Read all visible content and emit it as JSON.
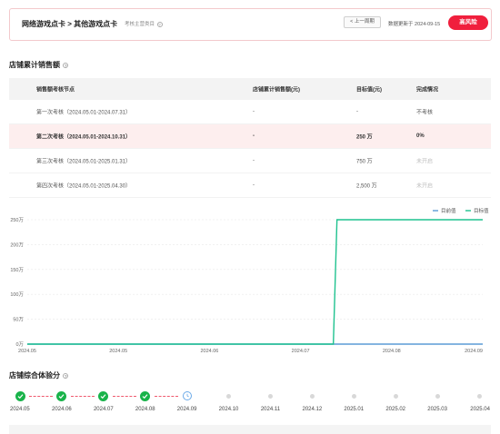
{
  "header": {
    "title": "网络游戏点卡 > 其他游戏点卡",
    "subtitle": "考核主营类目",
    "prev_button": "< 上一周期",
    "update_text": "数据更新于 2024-09-15",
    "risk_button": "高风险"
  },
  "sales_section": {
    "title": "店铺累计销售额",
    "columns": [
      "销售额考核节点",
      "店铺累计销售额(元)",
      "目标值(元)",
      "完成情况"
    ],
    "rows": [
      {
        "node": "第一次考核（2024.05.01-2024.07.31）",
        "sales": "-",
        "target": "-",
        "status": "不考核"
      },
      {
        "node": "第二次考核（2024.05.01-2024.10.31）",
        "sales": "-",
        "target": "250 万",
        "status": "0%"
      },
      {
        "node": "第三次考核（2024.05.01-2025.01.31）",
        "sales": "-",
        "target": "750 万",
        "status": "未开启"
      },
      {
        "node": "第四次考核（2024.05.01-2025.04.30）",
        "sales": "-",
        "target": "2,500 万",
        "status": "未开启"
      }
    ]
  },
  "chart_data": {
    "type": "line",
    "legend": [
      "目前值",
      "目标值"
    ],
    "legend_position": "top-right",
    "x_ticks": [
      "2024.05",
      "2024.05",
      "2024.06",
      "2024.07",
      "2024.08",
      "2024.09"
    ],
    "y_ticks": [
      "0万",
      "50万",
      "100万",
      "150万",
      "200万",
      "250万"
    ],
    "ylim": [
      0,
      250
    ],
    "series": [
      {
        "name": "目前值",
        "color": "#5b9bd5",
        "points": [
          [
            0,
            0
          ],
          [
            1,
            0
          ]
        ]
      },
      {
        "name": "目标值",
        "color": "#1fc28f",
        "points": [
          [
            0,
            0
          ],
          [
            0.672,
            0
          ],
          [
            0.68,
            250
          ],
          [
            1,
            250
          ]
        ]
      }
    ]
  },
  "score_section": {
    "title": "店铺综合体验分",
    "months": [
      "2024.05",
      "2024.06",
      "2024.07",
      "2024.08",
      "2024.09",
      "2024.10",
      "2024.11",
      "2024.12",
      "2025.01",
      "2025.02",
      "2025.03",
      "2025.04"
    ],
    "states": [
      "done",
      "done",
      "done",
      "done",
      "current",
      "future",
      "future",
      "future",
      "future",
      "future",
      "future",
      "future"
    ]
  },
  "colors": {
    "accent_red": "#f01f3d",
    "success_green": "#19b34a",
    "target_line": "#1fc28f",
    "current_line": "#5b9bd5"
  }
}
